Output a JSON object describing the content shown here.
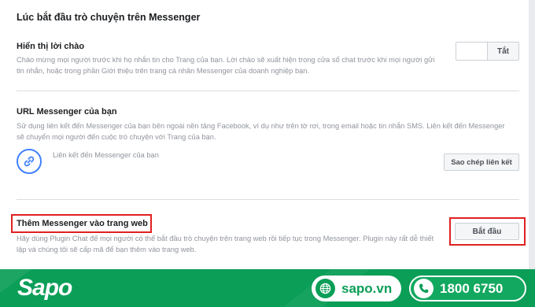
{
  "page": {
    "title": "Lúc bắt đầu trò chuyện trên Messenger"
  },
  "greeting": {
    "title": "Hiển thị lời chào",
    "desc_line1": "Chào mừng mọi người trước khi họ nhắn tin cho Trang của bạn. Lời chào sẽ xuất hiện trong cửa sổ chat trước khi mọi người gửi",
    "desc_line2": "tin nhắn, hoặc trong phần Giới thiệu trên trang cá nhân Messenger của doanh nghiệp bạn.",
    "toggle_state": "Tắt",
    "toggle_on": false
  },
  "messenger_url": {
    "title": "URL Messenger của bạn",
    "desc_line1": "Sử dụng liên kết đến Messenger của bạn bên ngoài nền tảng Facebook, ví dụ như trên tờ rơi, trong email hoặc tin nhắn SMS. Liên kết đến Messenger",
    "desc_line2": "sẽ chuyển mọi người đến cuộc trò chuyện với Trang của bạn.",
    "link_label": "Liên kết đến Messenger của bạn",
    "copy_button": "Sao chép liên kết"
  },
  "add_to_web": {
    "title": "Thêm Messenger vào trang web",
    "desc_line1": "Hãy dùng Plugin Chat để mọi người có thể bắt đầu trò chuyện trên trang web rồi tiếp tục trong Messenger. Plugin này rất dễ thiết",
    "desc_line2": "lập và chúng tôi sẽ cấp mã để bạn thêm vào trang web.",
    "start_button": "Bắt đầu"
  },
  "footer": {
    "logo": "Sapo",
    "website": "sapo.vn",
    "phone": "1800 6750",
    "website_icon": "globe-icon",
    "phone_icon": "phone-icon"
  },
  "colors": {
    "brand_green": "#0a9e57",
    "highlight_red": "#e02020",
    "link_blue": "#4080ff"
  }
}
